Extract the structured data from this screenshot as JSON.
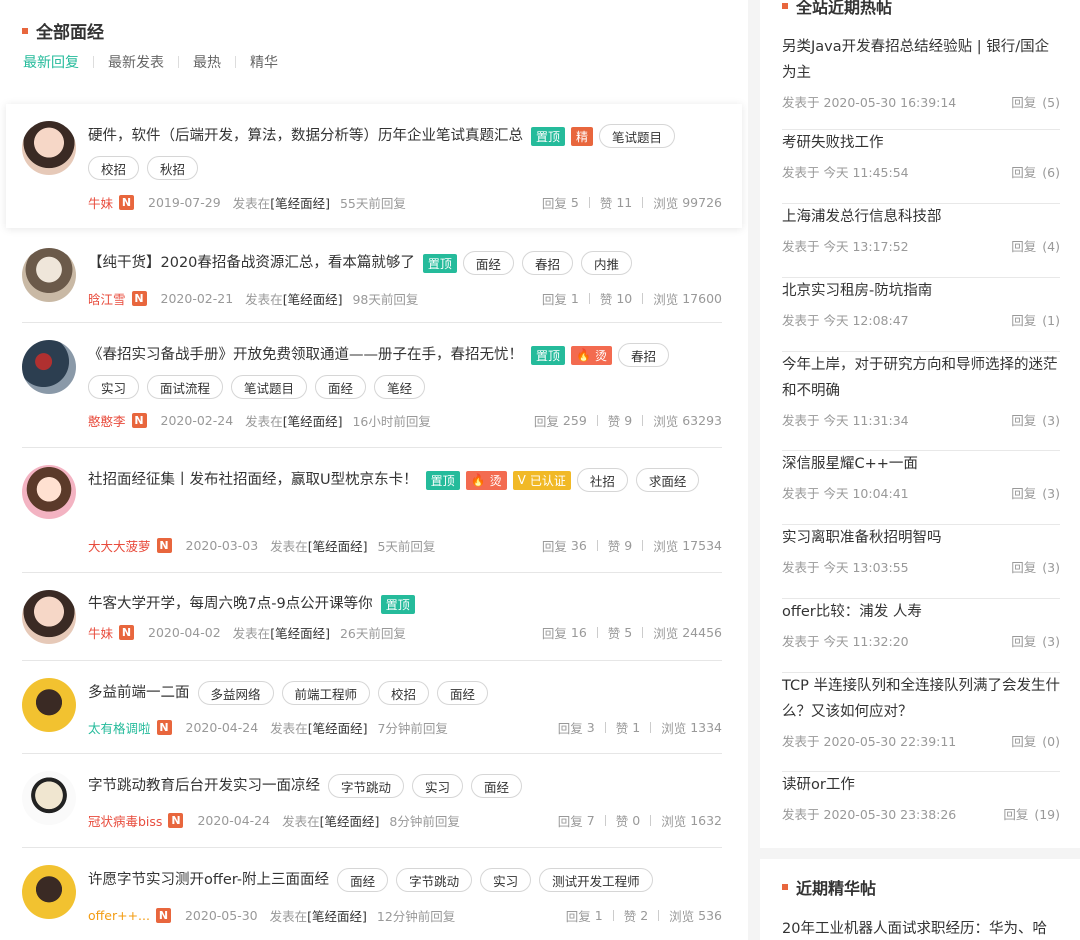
{
  "section": {
    "title": "全部面经"
  },
  "sort_tabs": [
    "最新回复",
    "最新发表",
    "最热",
    "精华"
  ],
  "labels": {
    "posted_in": "发表在",
    "reply": "回复",
    "like": "赞",
    "view": "浏览",
    "posted_at": "发表于"
  },
  "posts": [
    {
      "title": "硬件，软件（后端开发，算法，数据分析等）历年企业笔试真题汇总",
      "badges": [
        {
          "text": "置顶",
          "kind": "top"
        },
        {
          "text": "精",
          "kind": "jing"
        }
      ],
      "tags": [
        "笔试题目",
        "校招",
        "秋招"
      ],
      "author": "牛妹",
      "date": "2019-07-29",
      "board": "[笔经面经]",
      "ago": "55天前回复",
      "replies": "5",
      "likes": "11",
      "views": "99726"
    },
    {
      "title": "【纯干货】2020春招备战资源汇总，看本篇就够了",
      "badges": [
        {
          "text": "置顶",
          "kind": "top"
        }
      ],
      "tags": [
        "面经",
        "春招",
        "内推"
      ],
      "author": "晗江雪",
      "date": "2020-02-21",
      "board": "[笔经面经]",
      "ago": "98天前回复",
      "replies": "1",
      "likes": "10",
      "views": "17600"
    },
    {
      "title": "《春招实习备战手册》开放免费领取通道——册子在手，春招无忧！",
      "badges": [
        {
          "text": "置顶",
          "kind": "top"
        },
        {
          "text": "烫",
          "kind": "hot"
        }
      ],
      "tags": [
        "春招",
        "实习",
        "面试流程",
        "笔试题目",
        "面经",
        "笔经"
      ],
      "author": "憨憨李",
      "date": "2020-02-24",
      "board": "[笔经面经]",
      "ago": "16小时前回复",
      "replies": "259",
      "likes": "9",
      "views": "63293"
    },
    {
      "title": "社招面经征集丨发布社招面经，赢取U型枕京东卡！",
      "badges": [
        {
          "text": "置顶",
          "kind": "top"
        },
        {
          "text": "烫",
          "kind": "hot"
        },
        {
          "text": "已认证",
          "kind": "auth"
        }
      ],
      "tags": [
        "社招",
        "求面经"
      ],
      "author": "大大大菠萝",
      "date": "2020-03-03",
      "board": "[笔经面经]",
      "ago": "5天前回复",
      "replies": "36",
      "likes": "9",
      "views": "17534"
    },
    {
      "title": "牛客大学开学，每周六晚7点-9点公开课等你",
      "badges": [
        {
          "text": "置顶",
          "kind": "top"
        }
      ],
      "tags": [],
      "author": "牛妹",
      "date": "2020-04-02",
      "board": "[笔经面经]",
      "ago": "26天前回复",
      "replies": "16",
      "likes": "5",
      "views": "24456"
    },
    {
      "title": "多益前端一二面",
      "badges": [],
      "tags": [
        "多益网络",
        "前端工程师",
        "校招",
        "面经"
      ],
      "author": "太有格调啦",
      "date": "2020-04-24",
      "board": "[笔经面经]",
      "ago": "7分钟前回复",
      "replies": "3",
      "likes": "1",
      "views": "1334"
    },
    {
      "title": "字节跳动教育后台开发实习一面凉经",
      "badges": [],
      "tags": [
        "字节跳动",
        "实习",
        "面经"
      ],
      "author": "冠状病毒biss",
      "date": "2020-04-24",
      "board": "[笔经面经]",
      "ago": "8分钟前回复",
      "replies": "7",
      "likes": "0",
      "views": "1632"
    },
    {
      "title": "许愿字节实习测开offer-附上三面面经",
      "badges": [],
      "tags": [
        "面经",
        "字节跳动",
        "实习",
        "测试开发工程师"
      ],
      "author": "offer++...",
      "date": "2020-05-30",
      "board": "[笔经面经]",
      "ago": "12分钟前回复",
      "replies": "1",
      "likes": "2",
      "views": "536"
    }
  ],
  "hot": {
    "title": "全站近期热帖",
    "items": [
      {
        "title": "另类Java开发春招总结经验贴 | 银行/国企为主",
        "time": "2020-05-30 16:39:14",
        "replies": "(5)"
      },
      {
        "title": "考研失败找工作",
        "time": "今天 11:45:54",
        "replies": "(6)"
      },
      {
        "title": "上海浦发总行信息科技部",
        "time": "今天 13:17:52",
        "replies": "(4)"
      },
      {
        "title": "北京实习租房-防坑指南",
        "time": "今天 12:08:47",
        "replies": "(1)"
      },
      {
        "title": "今年上岸，对于研究方向和导师选择的迷茫和不明确",
        "time": "今天 11:31:34",
        "replies": "(3)"
      },
      {
        "title": "深信服星耀C++一面",
        "time": "今天 10:04:41",
        "replies": "(3)"
      },
      {
        "title": "实习离职准备秋招明智吗",
        "time": "今天 13:03:55",
        "replies": "(3)"
      },
      {
        "title": "offer比较：浦发 人寿",
        "time": "今天 11:32:20",
        "replies": "(3)"
      },
      {
        "title": "TCP 半连接队列和全连接队列满了会发生什么？又该如何应对？",
        "time": "2020-05-30 22:39:11",
        "replies": "(0)"
      },
      {
        "title": "读研or工作",
        "time": "2020-05-30 23:38:26",
        "replies": "(19)"
      }
    ]
  },
  "essence": {
    "title": "近期精华帖",
    "first_item": "20年工业机器人面试求职经历：华为、哈"
  },
  "colors": {
    "accent": "#25bb9b",
    "brand": "#e8663d",
    "author": "#e84c3d"
  }
}
